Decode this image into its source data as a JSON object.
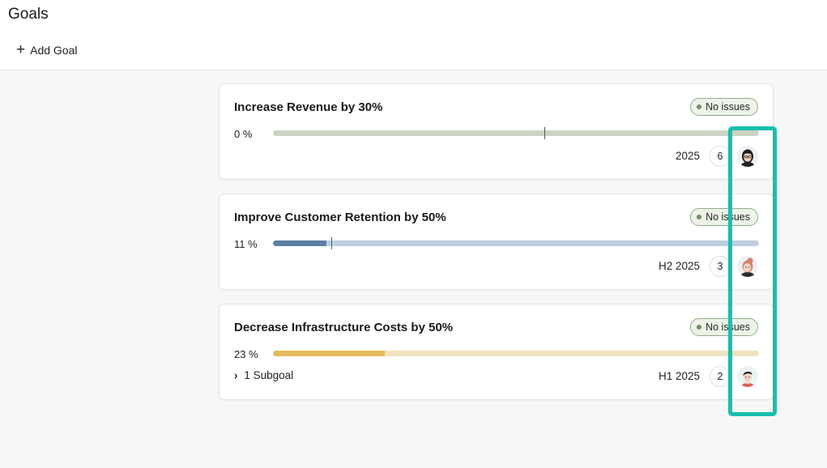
{
  "header": {
    "title": "Goals",
    "add_goal_label": "Add Goal"
  },
  "goals": [
    {
      "title": "Increase Revenue by 30%",
      "status": "No issues",
      "progress_label": "0 %",
      "progress": 0,
      "period": "2025",
      "count": "6",
      "owner_icon": "avatar-woman-dark-hair-glasses-icon",
      "colors": {
        "track": "#ccd3c3",
        "fill": "#9aa98d"
      }
    },
    {
      "title": "Improve Customer Retention by 50%",
      "status": "No issues",
      "progress_label": "11 %",
      "progress": 11,
      "period": "H2 2025",
      "count": "3",
      "owner_icon": "avatar-woman-red-bun-icon",
      "colors": {
        "track": "#bdcfdf",
        "fill": "#5b7fa6"
      }
    },
    {
      "title": "Decrease Infrastructure Costs by 50%",
      "status": "No issues",
      "progress_label": "23 %",
      "progress": 23,
      "period": "H1 2025",
      "count": "2",
      "subgoal_label": "1 Subgoal",
      "owner_icon": "avatar-man-dark-hair-icon",
      "colors": {
        "track": "#f1e2bf",
        "fill": "#e2bb5c"
      }
    }
  ],
  "status_color": "#6f8f66",
  "highlight_color": "#18bfae"
}
